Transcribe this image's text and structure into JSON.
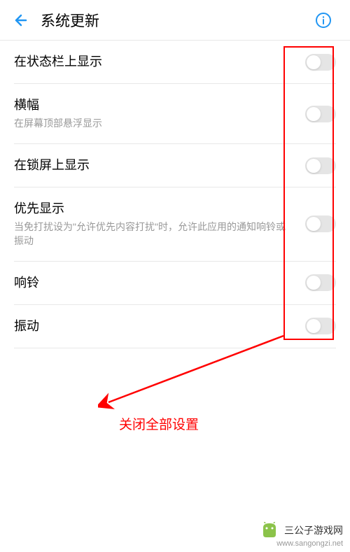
{
  "header": {
    "title": "系统更新"
  },
  "settings": [
    {
      "label": "在状态栏上显示",
      "desc": ""
    },
    {
      "label": "横幅",
      "desc": "在屏幕顶部悬浮显示"
    },
    {
      "label": "在锁屏上显示",
      "desc": ""
    },
    {
      "label": "优先显示",
      "desc": "当免打扰设为\"允许优先内容打扰\"时，允许此应用的通知响铃或振动"
    },
    {
      "label": "响铃",
      "desc": ""
    },
    {
      "label": "振动",
      "desc": ""
    }
  ],
  "annotation": {
    "text": "关闭全部设置"
  },
  "watermark": {
    "name": "三公子游戏网",
    "url": "www.sangongzi.net"
  }
}
